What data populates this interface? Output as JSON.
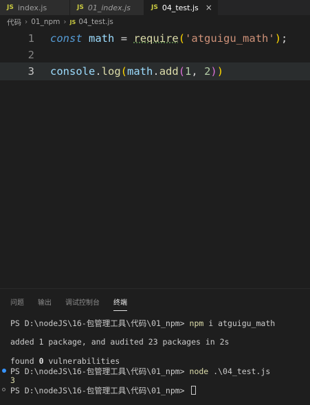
{
  "tabs": [
    {
      "icon": "JS",
      "name": "index.js",
      "italic": false
    },
    {
      "icon": "JS",
      "name": "01_index.js",
      "italic": true
    },
    {
      "icon": "JS",
      "name": "04_test.js",
      "italic": false,
      "close": "×"
    }
  ],
  "breadcrumb": {
    "items": [
      "代码",
      "01_npm"
    ],
    "file_icon": "JS",
    "file": "04_test.js",
    "separator": "›"
  },
  "editor": {
    "lines": [
      {
        "number": "1",
        "const": "const",
        "var": "math",
        "eq": "=",
        "require": "require",
        "open": "(",
        "string": "'atguigu_math'",
        "close": ")",
        "semi": ";"
      },
      {
        "number": "2"
      },
      {
        "number": "3",
        "obj": "console",
        "dot1": ".",
        "fn1": "log",
        "open1": "(",
        "arg": "math",
        "dot2": ".",
        "fn2": "add",
        "open2": "(",
        "n1": "1",
        "comma": ",",
        "n2": "2",
        "close2": ")",
        "close1": ")"
      }
    ]
  },
  "panel": {
    "tabs": [
      "问题",
      "输出",
      "调试控制台",
      "终端"
    ],
    "terminal": {
      "prompt1": "PS D:\\nodeJS\\16-包管理工具\\代码\\01_npm>",
      "cmd1": "npm",
      "args1": "i atguigu_math",
      "out1": "added 1 package, and audited 23 packages in 2s",
      "out2a": "found",
      "out2b": "0",
      "out2c": "vulnerabilities",
      "prompt2": "PS D:\\nodeJS\\16-包管理工具\\代码\\01_npm>",
      "cmd2": "node",
      "args2": ".\\04_test.js",
      "out3": "3",
      "prompt3": "PS D:\\nodeJS\\16-包管理工具\\代码\\01_npm>"
    }
  }
}
